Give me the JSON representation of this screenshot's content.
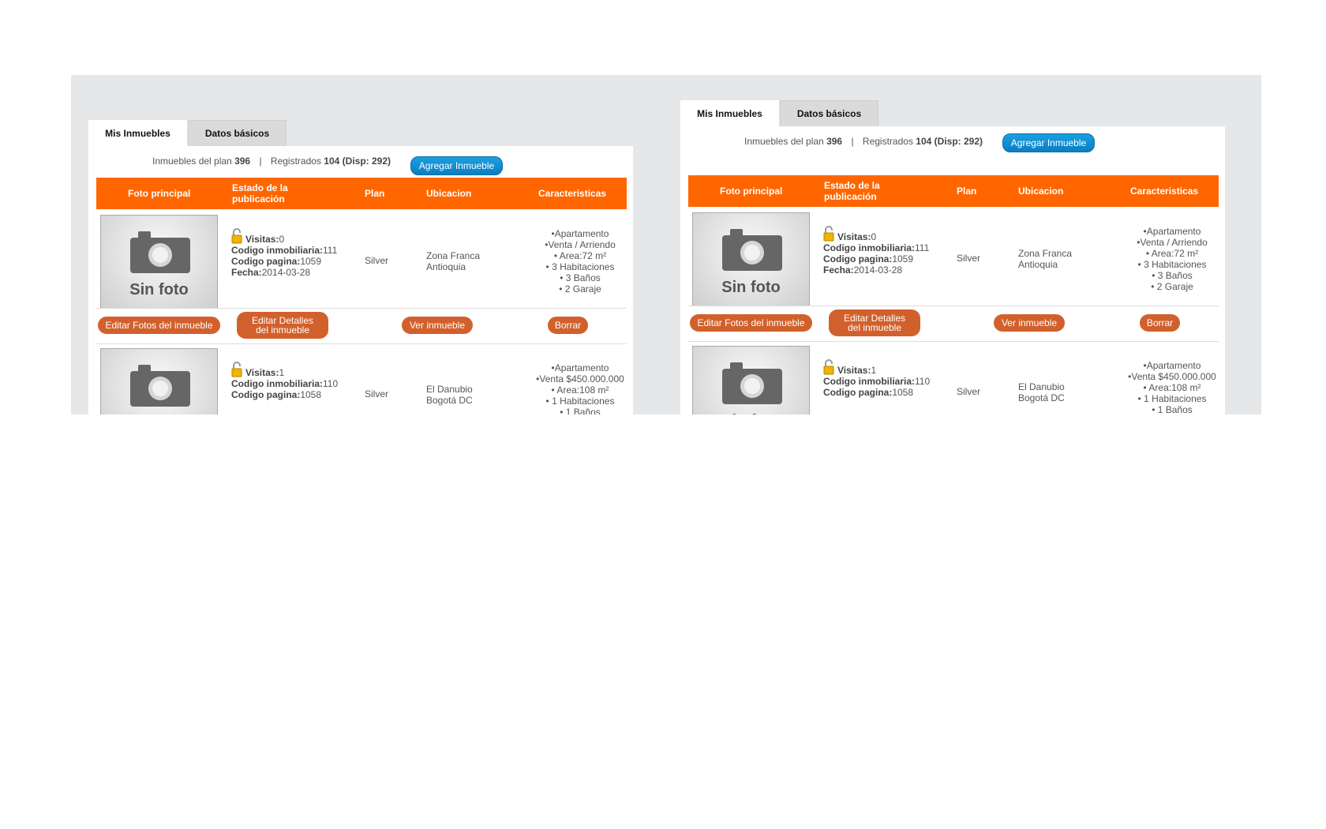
{
  "tabs": [
    "Mis Inmuebles",
    "Datos básicos"
  ],
  "summary": {
    "plan_label": "Inmuebles del plan",
    "plan_count": "396",
    "separator": "|",
    "registered_label": "Registrados",
    "registered_count": "104",
    "available": "(Disp: 292)"
  },
  "add_button": "Agregar Inmueble",
  "table": {
    "headers": [
      "Foto principal",
      "Estado de la publicación",
      "Plan",
      "Ubicacion",
      "Caracteristicas"
    ]
  },
  "no_photo_label": "Sin foto",
  "labels": {
    "visits": "Visitas:",
    "code_agency": "Codigo inmobiliaria:",
    "code_page": "Codigo pagina:",
    "date": "Fecha:"
  },
  "listings": [
    {
      "visits": "0",
      "code_agency": "111",
      "code_page": "1059",
      "date": "2014-03-28",
      "plan": "Silver",
      "location": [
        "Zona Franca",
        "Antioquia"
      ],
      "features": [
        "•Apartamento",
        "•Venta / Arriendo",
        "• Area:72 m²",
        "• 3 Habitaciones",
        "• 3 Baños",
        "• 2 Garaje"
      ]
    },
    {
      "visits": "1",
      "code_agency": "110",
      "code_page": "1058",
      "plan": "Silver",
      "location": [
        "El Danubio",
        "Bogotá DC"
      ],
      "features": [
        "•Apartamento",
        "•Venta $450.000.000",
        "• Area:108 m²",
        "• 1 Habitaciones",
        "• 1 Baños"
      ]
    }
  ],
  "row_actions": [
    "Editar Fotos del inmueble",
    "Editar Detalles del inmueble",
    "Ver inmueble",
    "Borrar"
  ],
  "colors": {
    "header_bg": "#ff6600",
    "action_btn": "#d2602c",
    "add_btn": "#0a7fc2",
    "stage_bg": "#e6e7e8"
  }
}
